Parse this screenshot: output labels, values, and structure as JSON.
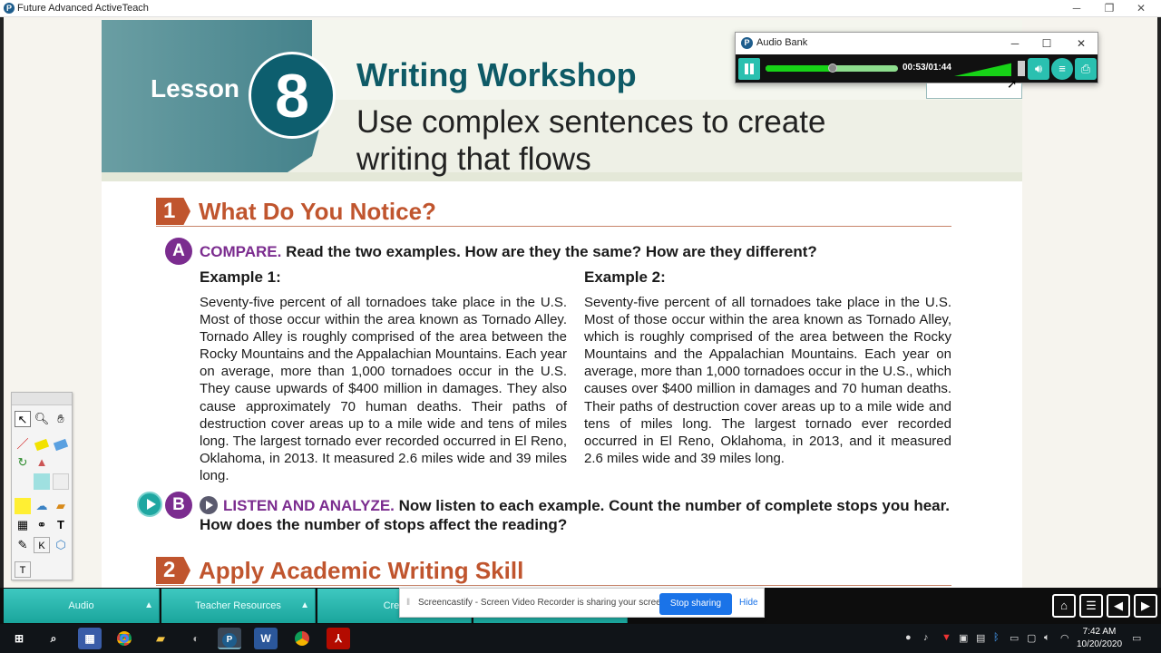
{
  "window": {
    "title": "Future Advanced ActiveTeach",
    "minimize": "─",
    "restore": "❐",
    "close": "✕"
  },
  "lesson": {
    "word": "Lesson",
    "number": "8",
    "title": "Writing Workshop",
    "subtitle": "Use complex sentences to create writing that flows"
  },
  "section1": {
    "num": "1",
    "label": "What Do You Notice?"
  },
  "partA": {
    "badge": "A",
    "keyword": "COMPARE.",
    "text": " Read the two examples. How are they the same? How are they different?",
    "example1": {
      "heading": "Example 1:",
      "body": "Seventy-five percent of all tornadoes take place in the U.S. Most of those occur within the area known as Tornado Alley. Tornado Alley is roughly comprised of the area between the Rocky Mountains and the Appalachian Mountains. Each year on average, more than 1,000 tornadoes occur in the U.S. They cause upwards of $400 million in damages. They also cause approximately 70 human deaths. Their paths of destruction cover areas up to a mile wide and tens of miles long. The largest tornado ever recorded occurred in El Reno, Oklahoma, in 2013. It measured 2.6 miles wide and 39 miles long."
    },
    "example2": {
      "heading": "Example 2:",
      "body": "Seventy-five percent of all tornadoes take place in the U.S. Most of those occur within the area known as Tornado Alley, which is roughly comprised of the area between the Rocky Mountains and the Appalachian Mountains. Each year on average, more than 1,000 tornadoes occur in the U.S., which causes over $400 million in damages and 70 human deaths. Their paths of destruction cover areas up to a mile wide and tens of miles long. The largest tornado ever recorded occurred in El Reno, Oklahoma, in 2013, and it measured 2.6 miles wide and 39 miles long."
    }
  },
  "partB": {
    "badge": "B",
    "keyword": "LISTEN AND ANALYZE.",
    "text": " Now listen to each example. Count the number of complete stops you hear. How does the number of stops affect the reading?"
  },
  "section2": {
    "num": "2",
    "label": "Apply Academic Writing Skill"
  },
  "audioBank": {
    "title": "Audio Bank",
    "time": "00:53/01:44",
    "progress": 0.51,
    "volume": 0.9,
    "minimize": "─",
    "maximize": "☐",
    "close": "✕"
  },
  "tools": {
    "text_tool": "T",
    "k_tool": "K"
  },
  "bottomTabs": [
    {
      "label": "Audio",
      "arrow": "▲"
    },
    {
      "label": "Teacher Resources",
      "arrow": "▲"
    },
    {
      "label": "Cred",
      "arrow": ""
    }
  ],
  "sharing": {
    "message": "Screencastify - Screen Video Recorder is sharing your screen.",
    "stop": "Stop sharing",
    "hide": "Hide"
  },
  "taskbar": {
    "time": "7:42 AM",
    "date": "10/20/2020"
  }
}
